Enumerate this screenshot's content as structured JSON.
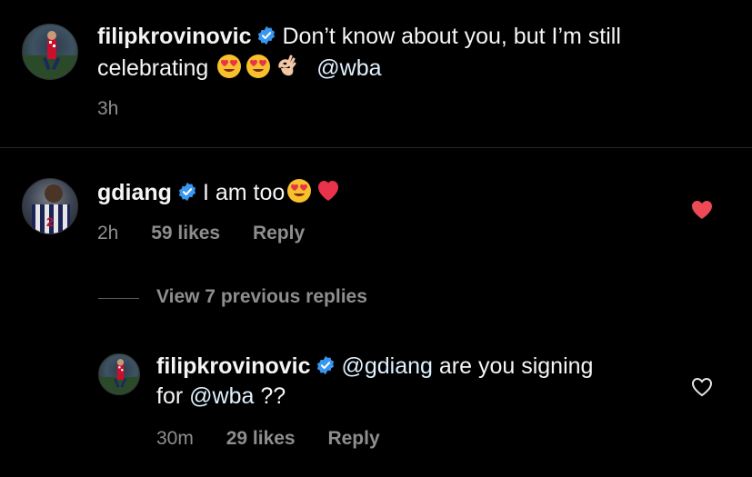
{
  "caption": {
    "username": "filipkrovinovic",
    "text_line1": "Don’t know about you, but I’m still",
    "text_line2": "celebrating",
    "mention": "@wba",
    "timestamp": "3h",
    "emojis": [
      "heart-eyes",
      "heart-eyes",
      "ok-hand"
    ]
  },
  "comments": [
    {
      "username": "gdiang",
      "text": "I am too",
      "emojis": [
        "heart-eyes",
        "red-heart"
      ],
      "time": "2h",
      "likes": "59 likes",
      "reply_label": "Reply",
      "liked": true
    }
  ],
  "view_replies": "View 7 previous replies",
  "reply": {
    "username": "filipkrovinovic",
    "mention": "@gdiang",
    "text_part1": "are you signing",
    "text_part2_prefix": "for",
    "mention2": "@wba",
    "text_part2_suffix": "??",
    "time": "30m",
    "likes": "29 likes",
    "reply_label": "Reply",
    "liked": false
  },
  "colors": {
    "background": "#000000",
    "text": "#f5f5f5",
    "meta": "#8e8e8e",
    "verified": "#3897f0",
    "like_red": "#ed4956"
  }
}
